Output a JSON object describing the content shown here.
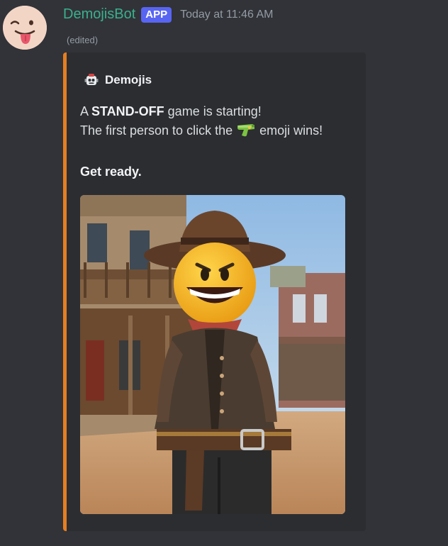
{
  "message": {
    "avatar_icon": "tongue-wink-emoji-icon",
    "username": "DemojisBot",
    "app_badge": "APP",
    "timestamp": "Today at 11:46 AM",
    "edited_label": "(edited)"
  },
  "embed": {
    "accent_color": "#e67e22",
    "author_icon": "robot-icon",
    "author_name": "Demojis",
    "line1_prefix": "A ",
    "line1_bold": "STAND-OFF",
    "line1_suffix": " game is starting!",
    "line2_prefix": "The first person to click the ",
    "line2_emoji_icon": "water-pistol-icon",
    "line2_suffix": " emoji wins!",
    "line3_bold": "Get ready.",
    "image_icon": "cowboy-emoji-western-town-image"
  }
}
